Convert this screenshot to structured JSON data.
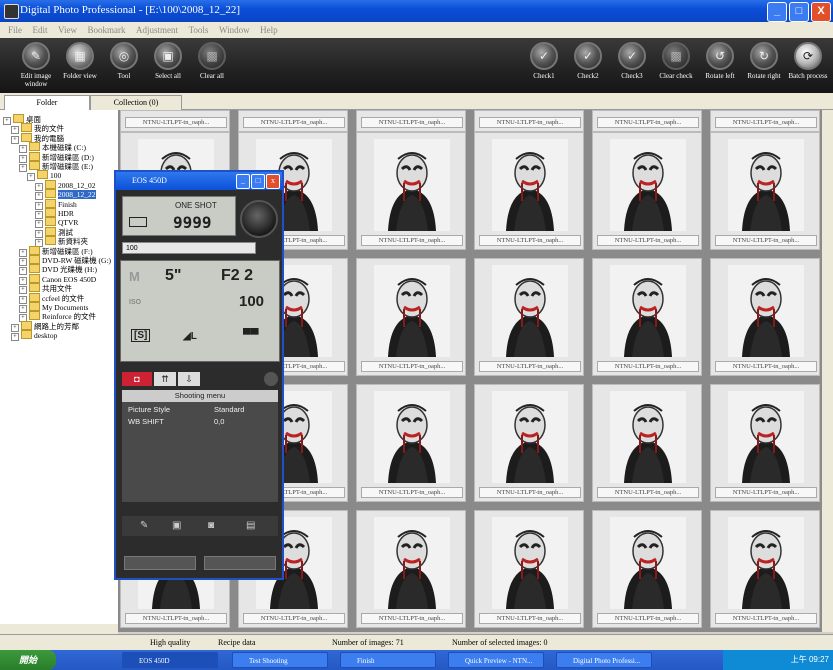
{
  "window": {
    "title": "Digital Photo Professional - [E:\\100\\2008_12_22]",
    "min": "_",
    "max": "□",
    "close": "X"
  },
  "menu": [
    "File",
    "Edit",
    "View",
    "Bookmark",
    "Adjustment",
    "Tools",
    "Window",
    "Help"
  ],
  "toolbar_left": [
    {
      "label": "Edit image window",
      "icon": "edit-image-icon"
    },
    {
      "label": "Folder view",
      "icon": "folder-view-icon"
    },
    {
      "label": "Tool",
      "icon": "tool-icon"
    },
    {
      "label": "Select all",
      "icon": "select-all-icon"
    },
    {
      "label": "Clear all",
      "icon": "clear-all-icon"
    }
  ],
  "toolbar_right": [
    {
      "label": "Check1",
      "icon": "check1-icon"
    },
    {
      "label": "Check2",
      "icon": "check2-icon"
    },
    {
      "label": "Check3",
      "icon": "check3-icon"
    },
    {
      "label": "Clear check",
      "icon": "clear-check-icon"
    },
    {
      "label": "Rotate left",
      "icon": "rotate-left-icon"
    },
    {
      "label": "Rotate right",
      "icon": "rotate-right-icon"
    },
    {
      "label": "Batch process",
      "icon": "batch-process-icon"
    }
  ],
  "tabs": {
    "folder": "Folder",
    "collection": "Collection (0)"
  },
  "tree": [
    {
      "label": "桌面",
      "indent": 0
    },
    {
      "label": "我的文件",
      "indent": 1
    },
    {
      "label": "我的電腦",
      "indent": 1
    },
    {
      "label": "本機磁碟 (C:)",
      "indent": 2
    },
    {
      "label": "新增磁碟區 (D:)",
      "indent": 2
    },
    {
      "label": "新增磁碟區 (E:)",
      "indent": 2
    },
    {
      "label": "100",
      "indent": 3
    },
    {
      "label": "2008_12_02",
      "indent": 4
    },
    {
      "label": "2008_12_22",
      "indent": 4,
      "selected": true
    },
    {
      "label": "Finish",
      "indent": 4
    },
    {
      "label": "HDR",
      "indent": 4
    },
    {
      "label": "QTVR",
      "indent": 4
    },
    {
      "label": "測試",
      "indent": 4
    },
    {
      "label": "新資料夾",
      "indent": 4
    },
    {
      "label": "新增磁碟區 (F:)",
      "indent": 2
    },
    {
      "label": "DVD-RW 磁碟機 (G:)",
      "indent": 2
    },
    {
      "label": "DVD 光碟機 (H:)",
      "indent": 2
    },
    {
      "label": "Canon EOS 450D",
      "indent": 2
    },
    {
      "label": "共用文件",
      "indent": 2
    },
    {
      "label": "ccfeel 的文件",
      "indent": 2
    },
    {
      "label": "My Documents",
      "indent": 2
    },
    {
      "label": "Reinforce 的文件",
      "indent": 2
    },
    {
      "label": "網路上的芳鄰",
      "indent": 1
    },
    {
      "label": "desktop",
      "indent": 1
    }
  ],
  "thumb_label": "NTNU-LTLPT-tn_oaph...",
  "status": {
    "quality": "High quality",
    "recipe": "Recipe data",
    "count": "Number of images: 71",
    "selected": "Number of selected images: 0"
  },
  "taskbar": {
    "start": "開始",
    "tasks": [
      "EOS 450D",
      "Test Shooting",
      "Finish",
      "Quick Preview - NTN...",
      "Digital Photo Professi..."
    ],
    "clock": "上午 09:27"
  },
  "eos": {
    "title": "EOS 450D",
    "mode": "ONE SHOT",
    "shots": "9999",
    "input": "100",
    "m": "M",
    "shutter": "5\"",
    "aperture": "F2 2",
    "iso_label": "ISO",
    "iso": "100",
    "quality": "◢L",
    "menu_title": "Shooting menu",
    "rows": [
      {
        "k": "Picture Style",
        "v": "Standard"
      },
      {
        "k": "WB SHIFT",
        "v": "0,0"
      }
    ]
  }
}
